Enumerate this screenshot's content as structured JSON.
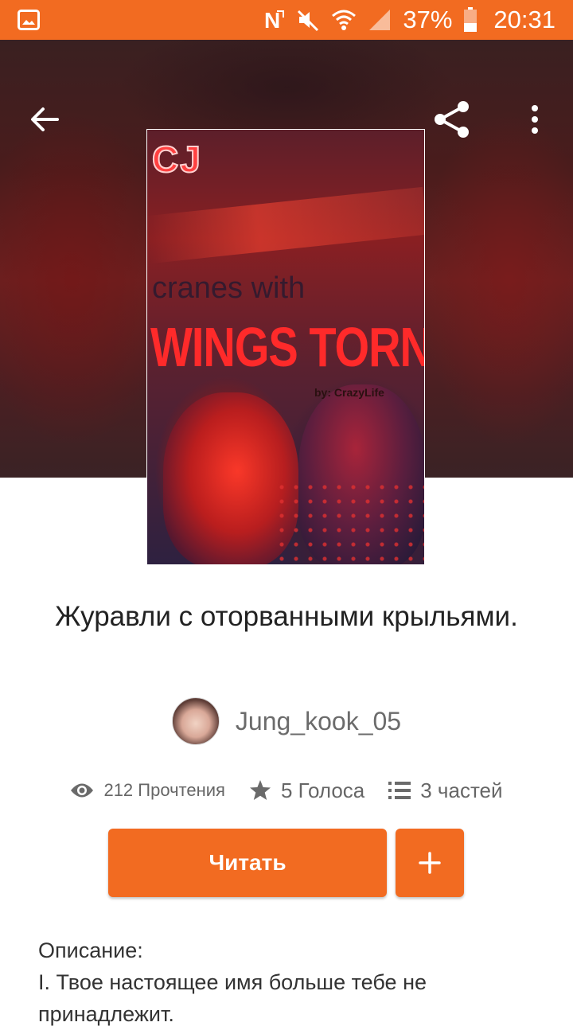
{
  "status_bar": {
    "battery_percent": "37%",
    "time": "20:31",
    "icons": [
      "gallery-icon",
      "nfc-icon",
      "mute-icon",
      "wifi-icon",
      "signal-icon",
      "battery-icon"
    ]
  },
  "toolbar": {
    "back_icon": "arrow-left-icon",
    "share_icon": "share-icon",
    "more_icon": "more-vert-icon"
  },
  "cover": {
    "lines": [
      "CJ",
      "cranes with",
      "WINGS TORN OFF",
      "by: CrazyLife"
    ]
  },
  "story": {
    "title": "Журавли с оторванными крыльями.",
    "author": "Jung_kook_05"
  },
  "stats": {
    "reads": "212 Прочтения",
    "votes": "5 Голоса",
    "parts": "3 частей"
  },
  "actions": {
    "read_label": "Читать",
    "add_label": "+"
  },
  "description": {
    "heading": "Описание:",
    "line1": "I. Твое настоящее имя больше тебе не",
    "line2": "принадлежит."
  },
  "colors": {
    "accent": "#f26b21"
  }
}
